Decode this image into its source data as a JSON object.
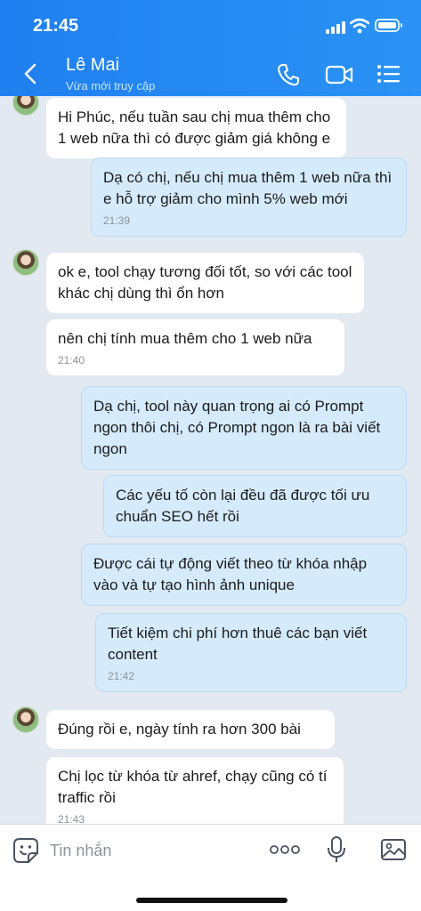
{
  "status_bar": {
    "time": "21:45"
  },
  "header": {
    "contact_name": "Lê Mai",
    "contact_status": "Vừa mới truy cập"
  },
  "icons": {
    "back": "chevron-left-icon",
    "call": "phone-icon",
    "video": "video-camera-icon",
    "menu": "list-menu-icon",
    "sticker": "smiley-sticker-icon",
    "more": "more-dots-icon",
    "mic": "microphone-icon",
    "image": "image-gallery-icon"
  },
  "messages": [
    {
      "direction": "in",
      "text": "Hi Phúc, nếu tuần sau chị mua thêm cho 1 web nữa thì có được giảm giá không e",
      "time": ""
    },
    {
      "direction": "out",
      "text": "Dạ có chị, nếu chị mua thêm 1 web nữa thì e hỗ trợ giảm cho mình 5% web mới",
      "time": "21:39"
    },
    {
      "direction": "in",
      "text": "ok e, tool chạy tương đối tốt, so với các tool khác chị dùng thì ổn hơn",
      "time": ""
    },
    {
      "direction": "in",
      "text": "nên chị tính mua thêm cho 1 web nữa",
      "time": "21:40"
    },
    {
      "direction": "out",
      "text": "Dạ chị, tool này quan trọng ai có Prompt ngon thôi chị, có Prompt ngon là ra bài viết ngon",
      "time": ""
    },
    {
      "direction": "out",
      "text": "Các yếu tố còn lại đều đã được tối ưu chuẩn SEO hết rồi",
      "time": ""
    },
    {
      "direction": "out",
      "text": "Được cái tự động viết theo từ khóa nhập vào và tự tạo hình ảnh unique",
      "time": ""
    },
    {
      "direction": "out",
      "text": "Tiết kiệm chi phí hơn thuê các bạn viết content",
      "time": "21:42"
    },
    {
      "direction": "in",
      "text": "Đúng rồi e, ngày tính ra hơn 300 bài",
      "time": ""
    },
    {
      "direction": "in",
      "text": "Chị lọc từ khóa từ ahref, chạy cũng có tí traffic rồi",
      "time": "21:43"
    }
  ],
  "composer": {
    "placeholder": "Tin nhắn"
  },
  "colors": {
    "header": "#1f7ff0",
    "incoming_bubble": "#ffffff",
    "outgoing_bubble": "#d5ebfc",
    "chat_background": "#e2e9f1"
  }
}
